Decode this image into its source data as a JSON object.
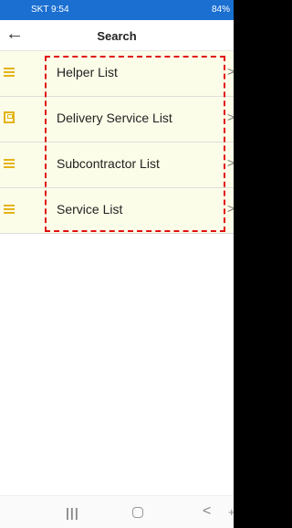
{
  "statusbar": {
    "left": "SKT 9:54",
    "right": "84%"
  },
  "header": {
    "back_icon": "←",
    "title": "Search"
  },
  "list": {
    "items": [
      {
        "label": "Helper List",
        "icon": "list-icon"
      },
      {
        "label": "Delivery Service List",
        "icon": "document-icon"
      },
      {
        "label": "Subcontractor List",
        "icon": "list-icon"
      },
      {
        "label": "Service List",
        "icon": "list-icon"
      }
    ],
    "chevron": ">"
  },
  "navbar": {
    "recent": "|||",
    "back": "<",
    "extra": "+"
  },
  "colors": {
    "status_bar": "#1a6fd1",
    "item_background": "#fcfde8",
    "icon_color": "#e3b317",
    "highlight_border": "#e01010"
  }
}
